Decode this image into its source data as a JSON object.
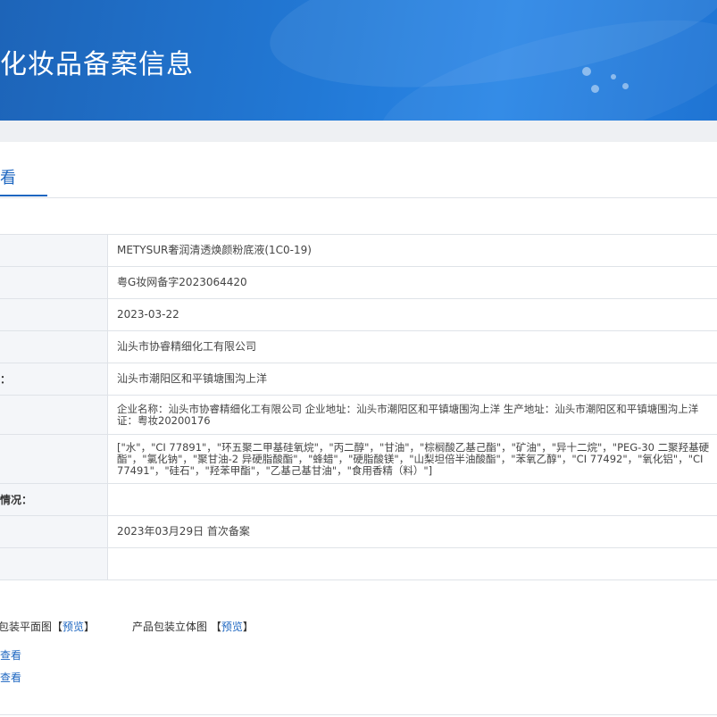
{
  "banner": {
    "title": "化妆品备案信息"
  },
  "tabs": [
    {
      "label": "看",
      "active": true
    }
  ],
  "info_rows": [
    {
      "label": "",
      "value": "METYSUR奢润清透焕颜粉底液(1C0-19)"
    },
    {
      "label": "",
      "value": "粤G妆网备字2023064420"
    },
    {
      "label": "",
      "value": "2023-03-22"
    },
    {
      "label": "",
      "value": "汕头市协睿精细化工有限公司"
    },
    {
      "label": "：",
      "value": "汕头市潮阳区和平镇塘围沟上洋"
    },
    {
      "label": "",
      "value": "企业名称：汕头市协睿精细化工有限公司 企业地址：汕头市潮阳区和平镇塘围沟上洋 生产地址：汕头市潮阳区和平镇塘围沟上洋\n证：粤妆20200176"
    },
    {
      "label": "",
      "value": "[\"水\"，\"CI 77891\"，\"环五聚二甲基硅氧烷\"，\"丙二醇\"，\"甘油\"，\"棕榈酸乙基己酯\"，\"矿油\"，\"异十二烷\"，\"PEG-30 二聚羟基硬\n酯\"，\"氯化钠\"，\"聚甘油-2 异硬脂酸酯\"，\"蜂蜡\"，\"硬脂酸镁\"，\"山梨坦倍半油酸酯\"，\"苯氧乙醇\"，\"CI 77492\"，\"氧化铝\"，\"CI\n77491\"，\"硅石\"，\"羟苯甲酯\"，\"乙基己基甘油\"，\"食用香精（料）\"]"
    },
    {
      "label": "情况：",
      "value": ""
    },
    {
      "label": "",
      "value": "2023年03月29日 首次备案"
    },
    {
      "label": "",
      "value": ""
    }
  ],
  "pictures": {
    "flat": {
      "label": "包装平面图",
      "bracket_open": "【",
      "link": "预览",
      "bracket_close": "】"
    },
    "stereo": {
      "label": "产品包装立体图",
      "bracket_open": "【",
      "link": "预览",
      "bracket_close": "】"
    }
  },
  "view_links": [
    "查看",
    "查看"
  ],
  "colors": {
    "banner": "#2279d6",
    "accent": "#1d66c0",
    "label_bg": "#f4f6f9",
    "border": "#dfe3e8"
  }
}
